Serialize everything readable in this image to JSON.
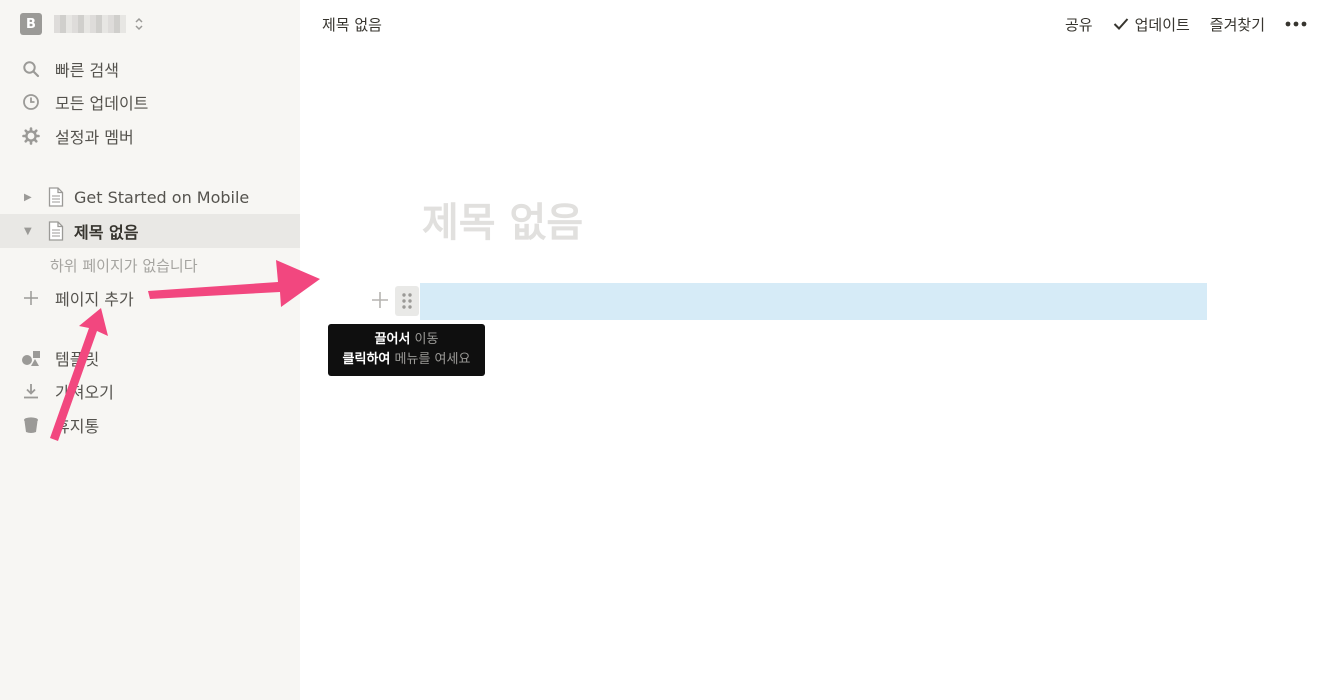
{
  "sidebar": {
    "workspace": {
      "initial": "B"
    },
    "nav": [
      {
        "label": "빠른 검색",
        "icon": "search-icon"
      },
      {
        "label": "모든 업데이트",
        "icon": "clock-icon"
      },
      {
        "label": "설정과 멤버",
        "icon": "gear-icon"
      }
    ],
    "pages": [
      {
        "label": "Get Started on Mobile",
        "expanded": false,
        "active": false
      },
      {
        "label": "제목 없음",
        "expanded": true,
        "active": true
      }
    ],
    "no_subpages": "하위 페이지가 없습니다",
    "add_page": "페이지 추가",
    "bottom": [
      {
        "label": "템플릿",
        "icon": "templates-icon"
      },
      {
        "label": "가져오기",
        "icon": "import-icon"
      },
      {
        "label": "휴지통",
        "icon": "trash-icon"
      }
    ]
  },
  "topbar": {
    "title": "제목 없음",
    "share": "공유",
    "updates": "업데이트",
    "favorite": "즐겨찾기"
  },
  "page": {
    "title_placeholder": "제목 없음"
  },
  "tooltip": {
    "drag_bold": "끌어서",
    "drag_rest": "이동",
    "click_bold": "클릭하여",
    "click_rest": "메뉴를 여세요"
  },
  "colors": {
    "annotation_arrow": "#f2477f",
    "selection": "#d6ebf7",
    "sidebar_bg": "#f7f6f3"
  }
}
